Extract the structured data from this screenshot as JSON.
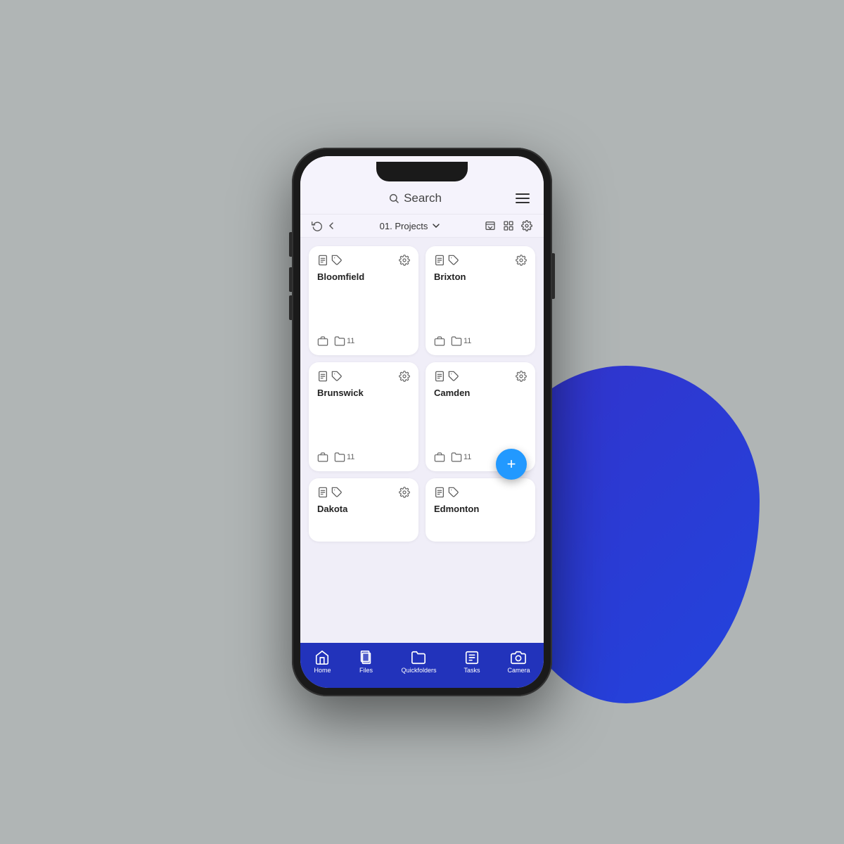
{
  "page": {
    "background": "#b0b5b5",
    "accent_blue": "#2233bb",
    "fab_color": "#2299ff"
  },
  "header": {
    "search_placeholder": "Search",
    "menu_label": "Menu"
  },
  "toolbar": {
    "folder_name": "01. Projects",
    "back_label": "Back",
    "history_label": "History",
    "download_label": "Download",
    "grid_label": "Grid",
    "settings_label": "Settings"
  },
  "projects": [
    {
      "name": "Bloomfield",
      "folder_count": "11"
    },
    {
      "name": "Brixton",
      "folder_count": "11"
    },
    {
      "name": "Brunswick",
      "folder_count": "11"
    },
    {
      "name": "Camden",
      "folder_count": "11"
    },
    {
      "name": "Dakota",
      "folder_count": ""
    },
    {
      "name": "Edmonton",
      "folder_count": ""
    }
  ],
  "nav": [
    {
      "label": "Home",
      "icon": "home"
    },
    {
      "label": "Files",
      "icon": "files"
    },
    {
      "label": "Quickfolders",
      "icon": "quickfolders"
    },
    {
      "label": "Tasks",
      "icon": "tasks"
    },
    {
      "label": "Camera",
      "icon": "camera"
    }
  ],
  "fab": {
    "label": "Add"
  }
}
